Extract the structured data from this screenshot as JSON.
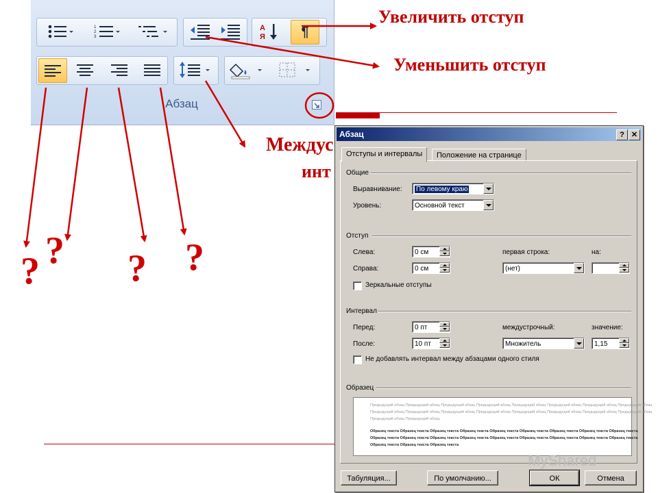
{
  "annotations": {
    "increase_indent": "Увеличить  отступ",
    "decrease_indent": "Уменьшить  отступ",
    "line_spacing_partial_1": "Междус",
    "line_spacing_partial_2": "инт",
    "question_marks": [
      "?",
      "?",
      "?",
      "?"
    ],
    "colors": {
      "annotation": "#c00000",
      "arrow": "#d00000"
    }
  },
  "ribbon": {
    "group_label": "Абзац",
    "buttons_row1": [
      "bullets-icon",
      "numbering-icon",
      "multilevel-list-icon",
      "decrease-indent-icon",
      "increase-indent-icon",
      "sort-icon",
      "show-marks-icon"
    ],
    "buttons_row2": [
      "align-left-icon",
      "align-center-icon",
      "align-right-icon",
      "justify-icon",
      "line-spacing-icon",
      "shading-icon",
      "borders-icon"
    ],
    "show_marks_glyph": "¶"
  },
  "dialog": {
    "title": "Абзац",
    "help_btn": "?",
    "close_btn": "✕",
    "tabs": [
      "Отступы и интервалы",
      "Положение на странице"
    ],
    "general": {
      "header": "Общие",
      "alignment_label": "Выравнивание:",
      "alignment_value": "По левому краю",
      "level_label": "Уровень:",
      "level_value": "Основной текст"
    },
    "indent": {
      "header": "Отступ",
      "left_label": "Слева:",
      "left_value": "0 см",
      "right_label": "Справа:",
      "right_value": "0 см",
      "first_line_label": "первая строка:",
      "first_line_value": "(нет)",
      "by_label": "на:",
      "by_value": "",
      "mirror_label": "Зеркальные отступы"
    },
    "spacing": {
      "header": "Интервал",
      "before_label": "Перед:",
      "before_value": "0 пт",
      "after_label": "После:",
      "after_value": "10 пт",
      "line_label": "междустрочный:",
      "line_value": "Множитель",
      "at_label": "значение:",
      "at_value": "1,15",
      "no_space_label": "Не добавлять интервал между абзацами одного стиля"
    },
    "preview": {
      "header": "Образец",
      "prev_lines": [
        "Предыдущий абзац Предыдущий абзац Предыдущий абзац Предыдущий абзац Предыдущий абзац Предыдущий абзац Предыдущий абзац Предыдущий абзац",
        "Предыдущий абзац Предыдущий абзац Предыдущий абзац Предыдущий абзац Предыдущий абзац Предыдущий абзац Предыдущий абзац Предыдущий абзац",
        "Предыдущий абзац Предыдущий абзац"
      ],
      "sample_lines": [
        "Образец текста Образец текста Образец текста Образец текста Образец текста Образец текста Образец текста Образец текста Образец текста",
        "Образец текста Образец текста Образец текста Образец текста Образец текста Образец текста Образец текста Образец текста Образец текста",
        "Образец текста Образец текста Образец текста"
      ]
    },
    "buttons": {
      "tabs": "Табуляция...",
      "default": "По умолчанию...",
      "ok": "ОК",
      "cancel": "Отмена"
    }
  },
  "watermark": "MyShared"
}
